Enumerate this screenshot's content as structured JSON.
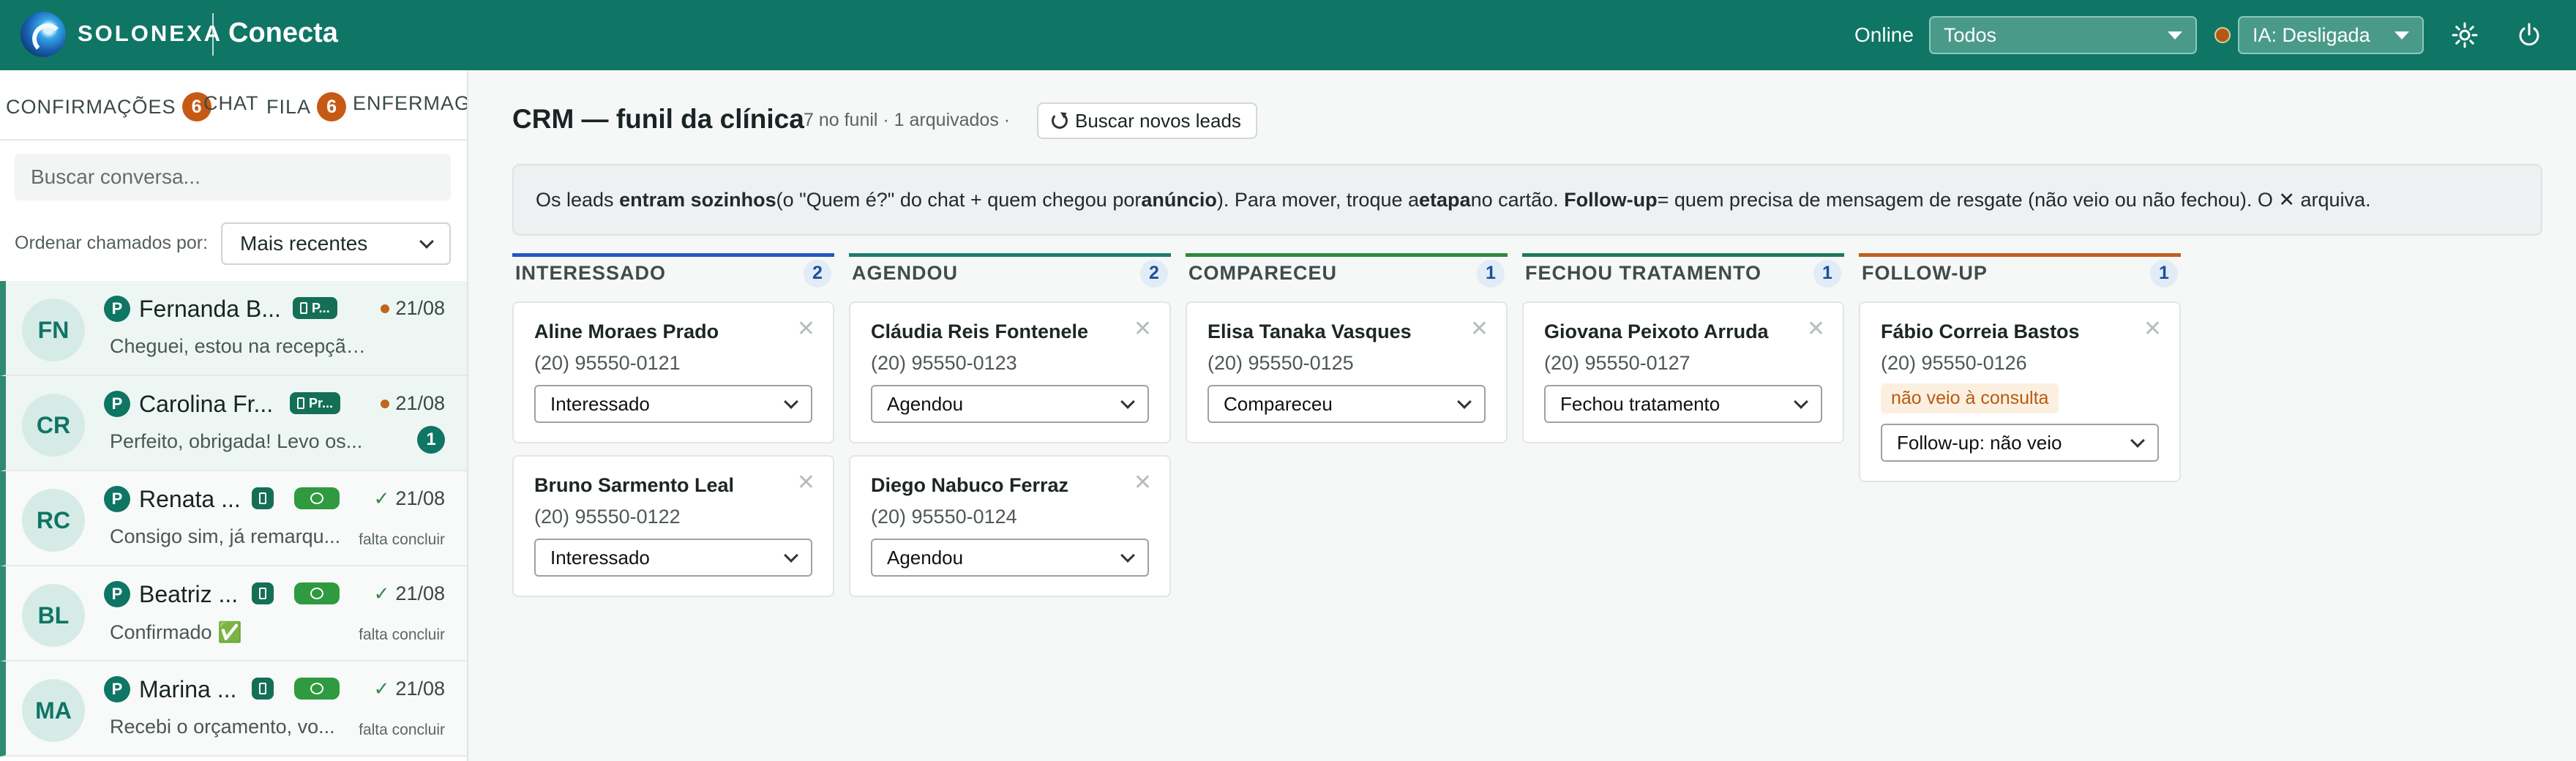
{
  "header": {
    "brand": "SOLONEXA",
    "app": "Conecta",
    "online_label": "Online",
    "filter_value": "Todos",
    "ia_value": "IA: Desligada",
    "colors": {
      "bar": "#0f7565",
      "status_dot": "#b15a16"
    },
    "icons": [
      "sun-icon",
      "power-icon"
    ]
  },
  "sidebar": {
    "tabs": [
      {
        "label": "CONFIRMAÇÕES",
        "badge": "6"
      },
      {
        "label": "CHAT"
      },
      {
        "label": "FILA",
        "badge": "6"
      },
      {
        "label": "ENFERMAGEM"
      }
    ],
    "search_placeholder": "Buscar conversa...",
    "sort_label": "Ordenar chamados por:",
    "sort_value": "Mais recentes",
    "conversations": [
      {
        "initials": "FN",
        "name": "Fernanda B...",
        "pill": "P...",
        "date": "21/08",
        "preview": "Cheguei, estou na recepção...",
        "mark": "dot"
      },
      {
        "initials": "CR",
        "name": "Carolina Fr...",
        "pill": "Pr...",
        "date": "21/08",
        "preview": "Perfeito, obrigada! Levo os...",
        "mark": "dot",
        "unread": "1"
      },
      {
        "initials": "RC",
        "name": "Renata ...",
        "date": "21/08",
        "preview": "Consigo sim, já remarqu...",
        "mark": "check",
        "status": "falta concluir"
      },
      {
        "initials": "BL",
        "name": "Beatriz ...",
        "date": "21/08",
        "preview": "Confirmado ✅",
        "mark": "check",
        "status": "falta concluir"
      },
      {
        "initials": "MA",
        "name": "Marina ...",
        "date": "21/08",
        "preview": "Recebi o orçamento, vo...",
        "mark": "check",
        "status": "falta concluir"
      }
    ]
  },
  "main": {
    "title": "CRM — funil da clínica",
    "meta": "7 no funil · 1 arquivados ·",
    "fetch_button": "Buscar novos leads",
    "info": {
      "t1": "Os leads ",
      "b1": "entram sozinhos",
      "t2": " (o \"Quem é?\" do chat + quem chegou por ",
      "b2": "anúncio",
      "t3": "). Para mover, troque a ",
      "b3": "etapa",
      "t4": " no cartão. ",
      "b4": "Follow-up",
      "t5": " = quem precisa de mensagem de resgate (não veio ou não fechou). O ✕ arquiva."
    },
    "columns": [
      {
        "title": "INTERESSADO",
        "count": "2",
        "color": "#2456c4",
        "cards": [
          {
            "name": "Aline Moraes Prado",
            "phone": "(20) 95550-0121",
            "stage": "Interessado"
          },
          {
            "name": "Bruno Sarmento Leal",
            "phone": "(20) 95550-0122",
            "stage": "Interessado"
          }
        ]
      },
      {
        "title": "AGENDOU",
        "count": "2",
        "color": "#1d7e6a",
        "cards": [
          {
            "name": "Cláudia Reis Fontenele",
            "phone": "(20) 95550-0123",
            "stage": "Agendou"
          },
          {
            "name": "Diego Nabuco Ferraz",
            "phone": "(20) 95550-0124",
            "stage": "Agendou"
          }
        ]
      },
      {
        "title": "COMPARECEU",
        "count": "1",
        "color": "#2e8a3e",
        "cards": [
          {
            "name": "Elisa Tanaka Vasques",
            "phone": "(20) 95550-0125",
            "stage": "Compareceu"
          }
        ]
      },
      {
        "title": "FECHOU TRATAMENTO",
        "count": "1",
        "color": "#1f7a58",
        "cards": [
          {
            "name": "Giovana Peixoto Arruda",
            "phone": "(20) 95550-0127",
            "stage": "Fechou tratamento"
          }
        ]
      },
      {
        "title": "FOLLOW-UP",
        "count": "1",
        "color": "#c0601c",
        "cards": [
          {
            "name": "Fábio Correia Bastos",
            "phone": "(20) 95550-0126",
            "tag": "não veio à consulta",
            "stage": "Follow-up: não veio"
          }
        ]
      }
    ]
  }
}
